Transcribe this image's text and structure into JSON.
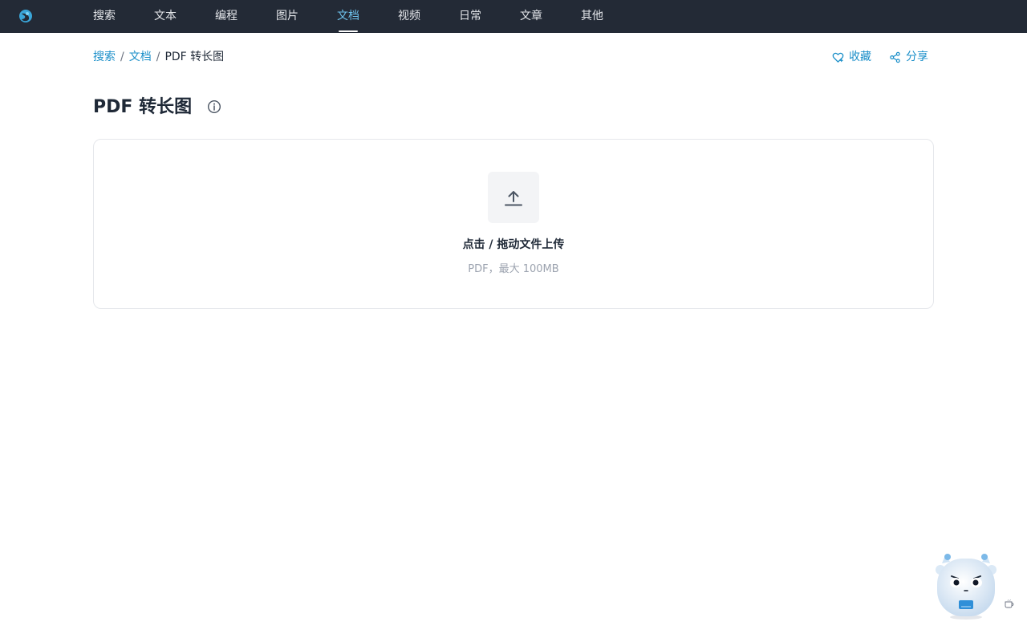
{
  "nav": {
    "items": [
      {
        "label": "搜索",
        "active": false
      },
      {
        "label": "文本",
        "active": false
      },
      {
        "label": "编程",
        "active": false
      },
      {
        "label": "图片",
        "active": false
      },
      {
        "label": "文档",
        "active": true
      },
      {
        "label": "视频",
        "active": false
      },
      {
        "label": "日常",
        "active": false
      },
      {
        "label": "文章",
        "active": false
      },
      {
        "label": "其他",
        "active": false
      }
    ]
  },
  "breadcrumb": {
    "items": [
      "搜索",
      "文档"
    ],
    "current": "PDF 转长图",
    "separator": "/"
  },
  "actions": {
    "favorite": "收藏",
    "share": "分享"
  },
  "page": {
    "title": "PDF 转长图"
  },
  "upload": {
    "label": "点击 / 拖动文件上传",
    "hint": "PDF，最大 100MB"
  },
  "colors": {
    "nav_bg": "#232a36",
    "accent": "#1b8fc9",
    "nav_active": "#6ec3ec"
  }
}
